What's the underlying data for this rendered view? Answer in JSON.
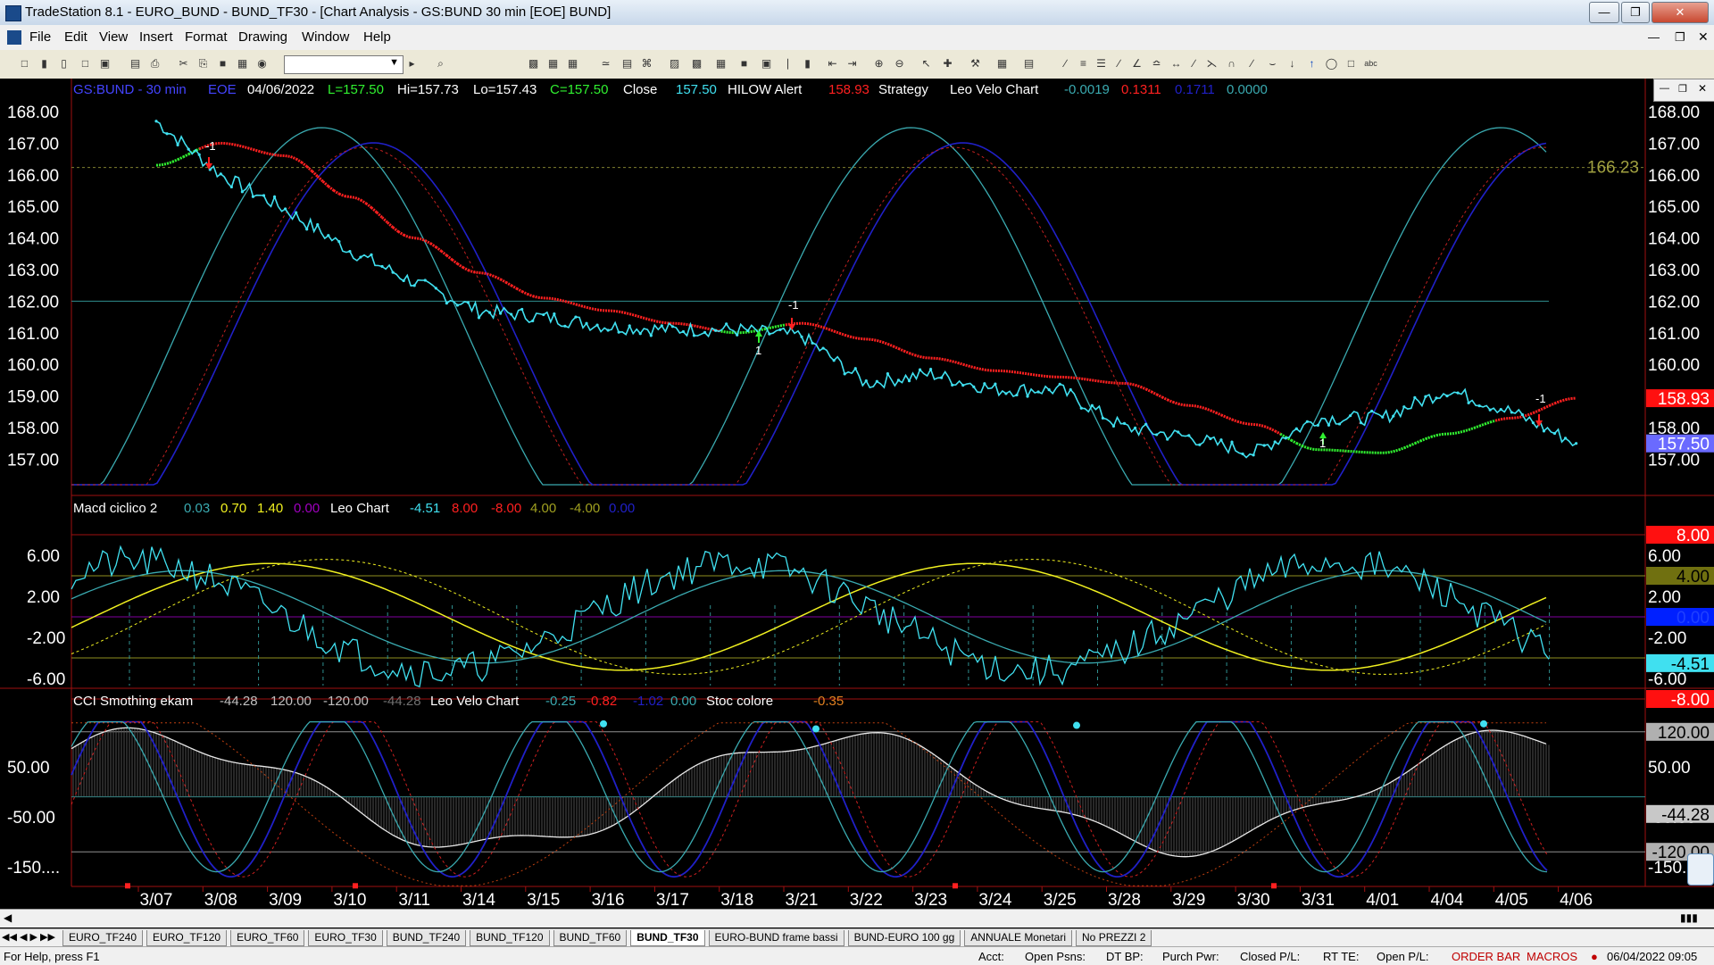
{
  "window": {
    "title": "TradeStation 8.1 - EURO_BUND - BUND_TF30 - [Chart Analysis - GS:BUND  30 min  [EOE] BUND]"
  },
  "menu": [
    "File",
    "Edit",
    "View",
    "Insert",
    "Format",
    "Drawing",
    "Window",
    "Help"
  ],
  "header": {
    "symbol": "GS:BUND - 30 min",
    "exchange": "EOE",
    "date": "04/06/2022",
    "last": "L=157.50",
    "high": "Hi=157.73",
    "low": "Lo=157.43",
    "close_val": "C=157.50",
    "close_label": "Close",
    "close_num": "157.50",
    "alert_label": "HILOW Alert",
    "alert_val": "158.93",
    "strategy_label": "Strategy",
    "velo_label": "Leo Velo Chart",
    "velo_vals": [
      "-0.0019",
      "0.1311",
      "0.1711",
      "0.0000"
    ]
  },
  "panel2": {
    "name": "Macd ciclico 2",
    "vals": [
      "0.03",
      "0.70",
      "1.40",
      "0.00"
    ],
    "leo_label": "Leo Chart",
    "leo_vals": [
      "-4.51",
      "8.00",
      "-8.00",
      "4.00",
      "-4.00",
      "0.00"
    ]
  },
  "panel3": {
    "name": "CCI Smothing ekam",
    "vals": [
      "-44.28",
      "120.00",
      "-120.00",
      "-44.28"
    ],
    "velo_label": "Leo Velo Chart",
    "velo_vals": [
      "-0.25",
      "-0.82",
      "-1.02",
      "0.00"
    ],
    "stoc_label": "Stoc colore",
    "stoc_val": "-0.35"
  },
  "price_axis": [
    "168.00",
    "167.00",
    "166.00",
    "165.00",
    "164.00",
    "163.00",
    "162.00",
    "161.00",
    "160.00",
    "159.00",
    "158.00",
    "157.00"
  ],
  "macd_axis": [
    "6.00",
    "2.00",
    "-2.00",
    "-6.00"
  ],
  "cci_axis": [
    "50.00",
    "-50.00",
    "-150...."
  ],
  "right_price_axis": [
    "168.00",
    "167.00",
    "166.00",
    "165.00",
    "164.00",
    "163.00",
    "162.00",
    "161.00",
    "160.00",
    "159.00",
    "158.00",
    "157.00"
  ],
  "right_macd_axis": [
    "6.00",
    "2.00",
    "-2.00",
    "-6.00"
  ],
  "right_cci_axis": [
    "50.00",
    "-50.00",
    "-150...."
  ],
  "markers": {
    "hline_price": "166.23",
    "price_badge_red": "158.93",
    "price_badge_blue": "157.50",
    "macd_badges": [
      "8.00",
      "4.00",
      "0.00",
      "-4.51",
      "-8.00"
    ],
    "cci_badges": [
      "120.00",
      "-44.28",
      "-120.00"
    ]
  },
  "x_axis": [
    "3/07",
    "3/08",
    "3/09",
    "3/10",
    "3/11",
    "3/14",
    "3/15",
    "3/16",
    "3/17",
    "3/18",
    "3/21",
    "3/22",
    "3/23",
    "3/24",
    "3/25",
    "3/28",
    "3/29",
    "3/30",
    "3/31",
    "4/01",
    "4/04",
    "4/05",
    "4/06"
  ],
  "tabs": [
    "EURO_TF240",
    "EURO_TF120",
    "EURO_TF60",
    "EURO_TF30",
    "BUND_TF240",
    "BUND_TF120",
    "BUND_TF60",
    "BUND_TF30",
    "EURO-BUND frame bassi",
    "BUND-EURO 100 gg",
    "ANNUALE Monetari",
    "No PREZZI 2"
  ],
  "active_tab": "BUND_TF30",
  "status": {
    "help": "For Help, press F1",
    "acct": "Acct:",
    "open_psns": "Open Psns:",
    "dt_bp": "DT BP:",
    "purch_pwr": "Purch Pwr:",
    "closed_pl": "Closed P/L:",
    "rt_te": "RT TE:",
    "open_pl": "Open P/L:",
    "order_bar": "ORDER BAR",
    "macros": "MACROS",
    "datetime": "06/04/2022 09:05"
  },
  "chart_data": {
    "type": "line",
    "title": "GS:BUND - 30 min",
    "x": [
      "3/07",
      "3/08",
      "3/09",
      "3/10",
      "3/11",
      "3/14",
      "3/15",
      "3/16",
      "3/17",
      "3/18",
      "3/21",
      "3/22",
      "3/23",
      "3/24",
      "3/25",
      "3/28",
      "3/29",
      "3/30",
      "3/31",
      "4/01",
      "4/04",
      "4/05",
      "4/06"
    ],
    "series": [
      {
        "name": "Close",
        "values": [
          167.7,
          166.0,
          164.9,
          163.6,
          162.6,
          161.7,
          161.5,
          161.2,
          161.1,
          161.1,
          160.9,
          159.4,
          159.7,
          159.2,
          159.2,
          158.0,
          157.7,
          157.2,
          158.3,
          158.3,
          159.2,
          158.5,
          157.5
        ]
      },
      {
        "name": "HILOW Alert",
        "values": [
          166.3,
          167.0,
          166.6,
          165.3,
          164.0,
          162.9,
          162.1,
          161.7,
          161.3,
          161.0,
          161.3,
          160.8,
          160.2,
          159.8,
          159.6,
          159.4,
          158.7,
          158.1,
          157.3,
          157.2,
          157.8,
          158.3,
          158.93
        ]
      }
    ],
    "ylim": [
      156.5,
      168.5
    ],
    "grid": false
  },
  "colors": {
    "background": "#000000",
    "price": "#40e0f0",
    "hilow_red": "#ff2020",
    "hilow_green": "#30f030",
    "blue_osc": "#2020c8",
    "teal_osc": "#3aaab0",
    "yellow": "#f0f020",
    "axis_text": "#ffffff"
  }
}
